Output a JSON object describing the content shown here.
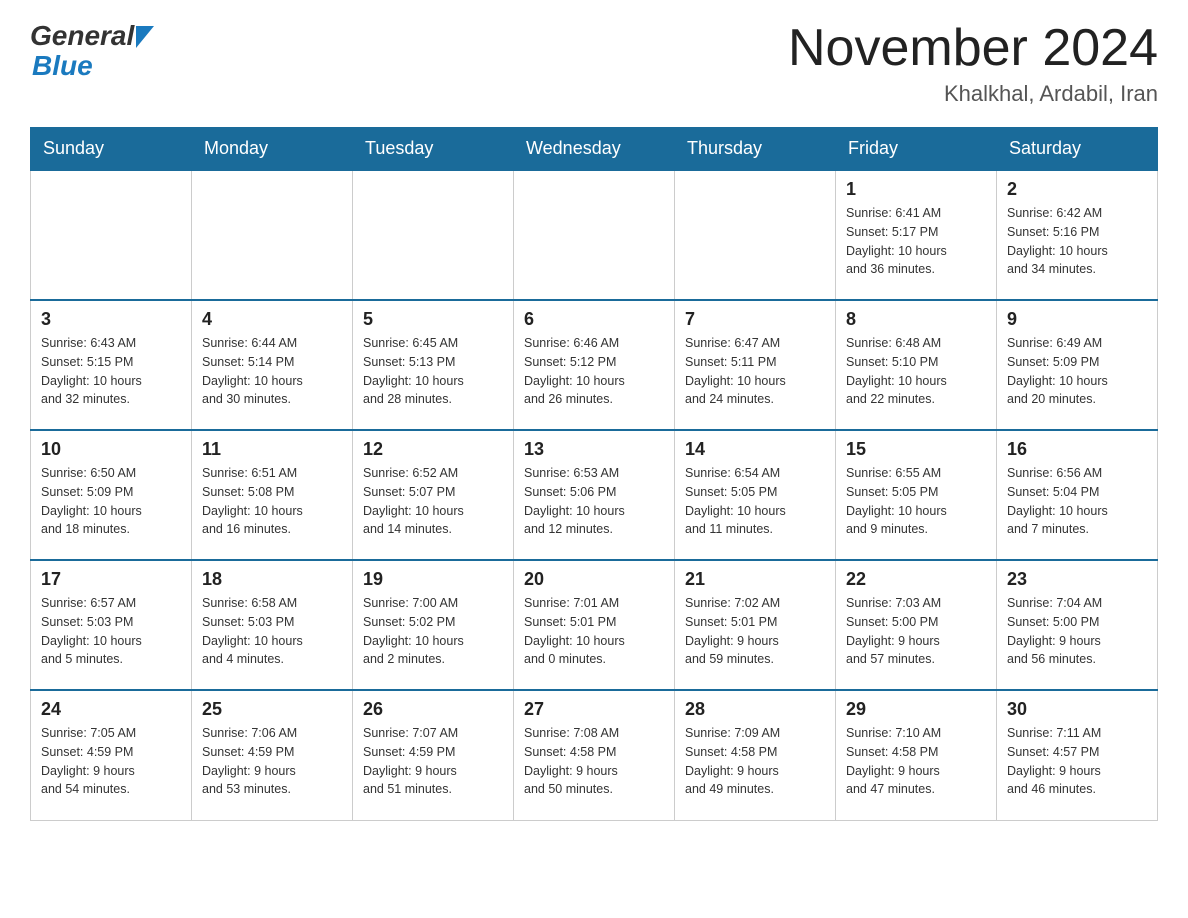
{
  "header": {
    "logo_general": "General",
    "logo_blue": "Blue",
    "title": "November 2024",
    "location": "Khalkhal, Ardabil, Iran"
  },
  "weekdays": [
    "Sunday",
    "Monday",
    "Tuesday",
    "Wednesday",
    "Thursday",
    "Friday",
    "Saturday"
  ],
  "weeks": [
    [
      {
        "day": "",
        "info": ""
      },
      {
        "day": "",
        "info": ""
      },
      {
        "day": "",
        "info": ""
      },
      {
        "day": "",
        "info": ""
      },
      {
        "day": "",
        "info": ""
      },
      {
        "day": "1",
        "info": "Sunrise: 6:41 AM\nSunset: 5:17 PM\nDaylight: 10 hours\nand 36 minutes."
      },
      {
        "day": "2",
        "info": "Sunrise: 6:42 AM\nSunset: 5:16 PM\nDaylight: 10 hours\nand 34 minutes."
      }
    ],
    [
      {
        "day": "3",
        "info": "Sunrise: 6:43 AM\nSunset: 5:15 PM\nDaylight: 10 hours\nand 32 minutes."
      },
      {
        "day": "4",
        "info": "Sunrise: 6:44 AM\nSunset: 5:14 PM\nDaylight: 10 hours\nand 30 minutes."
      },
      {
        "day": "5",
        "info": "Sunrise: 6:45 AM\nSunset: 5:13 PM\nDaylight: 10 hours\nand 28 minutes."
      },
      {
        "day": "6",
        "info": "Sunrise: 6:46 AM\nSunset: 5:12 PM\nDaylight: 10 hours\nand 26 minutes."
      },
      {
        "day": "7",
        "info": "Sunrise: 6:47 AM\nSunset: 5:11 PM\nDaylight: 10 hours\nand 24 minutes."
      },
      {
        "day": "8",
        "info": "Sunrise: 6:48 AM\nSunset: 5:10 PM\nDaylight: 10 hours\nand 22 minutes."
      },
      {
        "day": "9",
        "info": "Sunrise: 6:49 AM\nSunset: 5:09 PM\nDaylight: 10 hours\nand 20 minutes."
      }
    ],
    [
      {
        "day": "10",
        "info": "Sunrise: 6:50 AM\nSunset: 5:09 PM\nDaylight: 10 hours\nand 18 minutes."
      },
      {
        "day": "11",
        "info": "Sunrise: 6:51 AM\nSunset: 5:08 PM\nDaylight: 10 hours\nand 16 minutes."
      },
      {
        "day": "12",
        "info": "Sunrise: 6:52 AM\nSunset: 5:07 PM\nDaylight: 10 hours\nand 14 minutes."
      },
      {
        "day": "13",
        "info": "Sunrise: 6:53 AM\nSunset: 5:06 PM\nDaylight: 10 hours\nand 12 minutes."
      },
      {
        "day": "14",
        "info": "Sunrise: 6:54 AM\nSunset: 5:05 PM\nDaylight: 10 hours\nand 11 minutes."
      },
      {
        "day": "15",
        "info": "Sunrise: 6:55 AM\nSunset: 5:05 PM\nDaylight: 10 hours\nand 9 minutes."
      },
      {
        "day": "16",
        "info": "Sunrise: 6:56 AM\nSunset: 5:04 PM\nDaylight: 10 hours\nand 7 minutes."
      }
    ],
    [
      {
        "day": "17",
        "info": "Sunrise: 6:57 AM\nSunset: 5:03 PM\nDaylight: 10 hours\nand 5 minutes."
      },
      {
        "day": "18",
        "info": "Sunrise: 6:58 AM\nSunset: 5:03 PM\nDaylight: 10 hours\nand 4 minutes."
      },
      {
        "day": "19",
        "info": "Sunrise: 7:00 AM\nSunset: 5:02 PM\nDaylight: 10 hours\nand 2 minutes."
      },
      {
        "day": "20",
        "info": "Sunrise: 7:01 AM\nSunset: 5:01 PM\nDaylight: 10 hours\nand 0 minutes."
      },
      {
        "day": "21",
        "info": "Sunrise: 7:02 AM\nSunset: 5:01 PM\nDaylight: 9 hours\nand 59 minutes."
      },
      {
        "day": "22",
        "info": "Sunrise: 7:03 AM\nSunset: 5:00 PM\nDaylight: 9 hours\nand 57 minutes."
      },
      {
        "day": "23",
        "info": "Sunrise: 7:04 AM\nSunset: 5:00 PM\nDaylight: 9 hours\nand 56 minutes."
      }
    ],
    [
      {
        "day": "24",
        "info": "Sunrise: 7:05 AM\nSunset: 4:59 PM\nDaylight: 9 hours\nand 54 minutes."
      },
      {
        "day": "25",
        "info": "Sunrise: 7:06 AM\nSunset: 4:59 PM\nDaylight: 9 hours\nand 53 minutes."
      },
      {
        "day": "26",
        "info": "Sunrise: 7:07 AM\nSunset: 4:59 PM\nDaylight: 9 hours\nand 51 minutes."
      },
      {
        "day": "27",
        "info": "Sunrise: 7:08 AM\nSunset: 4:58 PM\nDaylight: 9 hours\nand 50 minutes."
      },
      {
        "day": "28",
        "info": "Sunrise: 7:09 AM\nSunset: 4:58 PM\nDaylight: 9 hours\nand 49 minutes."
      },
      {
        "day": "29",
        "info": "Sunrise: 7:10 AM\nSunset: 4:58 PM\nDaylight: 9 hours\nand 47 minutes."
      },
      {
        "day": "30",
        "info": "Sunrise: 7:11 AM\nSunset: 4:57 PM\nDaylight: 9 hours\nand 46 minutes."
      }
    ]
  ]
}
